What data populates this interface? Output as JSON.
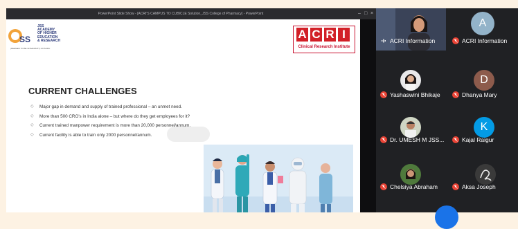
{
  "window": {
    "title": "PowerPoint Slide Show - [ACRI'S CAMPUS TO CUBICLE Solution_JSS College of Pharmacy] - PowerPoint",
    "controls": [
      "–",
      "□",
      "×"
    ]
  },
  "slide": {
    "jss_logo_text": "JSS\nACADEMY\nOF HIGHER\nEDUCATION\n& RESEARCH",
    "jss_logo_sub": "(DEEMED TO BE UNIVERSITY)  MYSURU",
    "acri_logo_letters": [
      "A",
      "C",
      "R",
      "I"
    ],
    "acri_logo_sub": "Clinical Research Institute",
    "heading": "CURRENT CHALLENGES",
    "bullets": [
      "Major gap in demand and supply of trained professional – an unmet need.",
      "More than 500 CRO's in India alone – but where do they get employees for it?",
      "Current trained manpower requirement is more than 20,000 personnel/annum.",
      "Current facility is able to train only 2000 personnel/annum."
    ]
  },
  "participants": [
    {
      "name": "ACRI Information",
      "type": "video",
      "mic": "on"
    },
    {
      "name": "ACRI Information",
      "type": "initial",
      "initial": "A",
      "color": "#93b3c9",
      "mic": "off"
    },
    {
      "name": "Yashaswini Bhikaje",
      "type": "photo",
      "mic": "off"
    },
    {
      "name": "Dhanya Mary",
      "type": "initial",
      "initial": "D",
      "color": "#8d5b4c",
      "mic": "off"
    },
    {
      "name": "Dr. UMESH M JSS...",
      "type": "photo",
      "mic": "off"
    },
    {
      "name": "Kajal Raigur",
      "type": "initial",
      "initial": "K",
      "color": "#039be5",
      "mic": "off"
    },
    {
      "name": "Chelsiya Abraham",
      "type": "photo",
      "mic": "off"
    },
    {
      "name": "Aksa Joseph",
      "type": "photo",
      "mic": "off"
    }
  ],
  "colors": {
    "acri_red": "#d21f27",
    "mic_off": "#ea4335",
    "tile_bg": "#3c4043"
  }
}
